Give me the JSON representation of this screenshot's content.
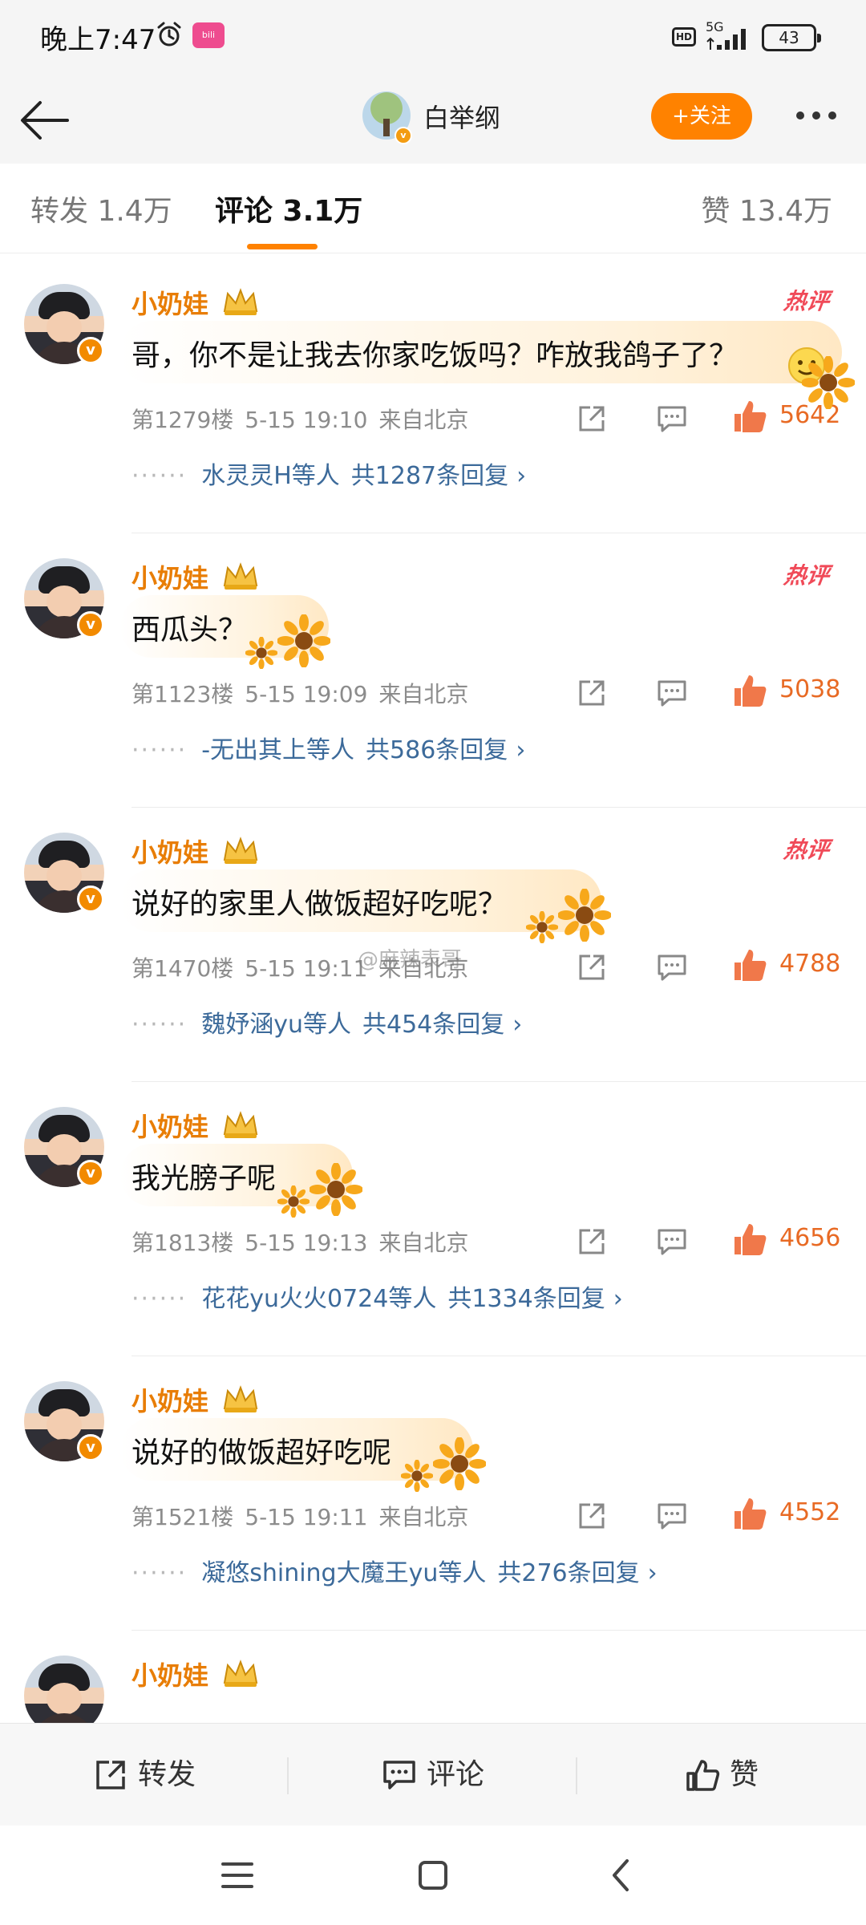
{
  "status_bar": {
    "time": "晚上7:47",
    "network": "5G",
    "hd": "HD",
    "battery": "43"
  },
  "header": {
    "user_name": "白举纲",
    "follow_label": "+关注"
  },
  "tabs": {
    "repost": "转发 1.4万",
    "comments": "评论 3.1万",
    "likes": "赞 13.4万"
  },
  "comments": [
    {
      "user": "小奶娃",
      "hot": "热评",
      "text": "哥，你不是让我去你家吃饭吗？咋放我鸽子了？",
      "floor": "第1279楼",
      "date": "5-15 19:10",
      "location": "来自北京",
      "likes": "5642",
      "reply_users": "水灵灵H等人",
      "reply_total": "共1287条回复"
    },
    {
      "user": "小奶娃",
      "hot": "热评",
      "text": "西瓜头？",
      "floor": "第1123楼",
      "date": "5-15 19:09",
      "location": "来自北京",
      "likes": "5038",
      "reply_users": "-无出其上等人",
      "reply_total": "共586条回复"
    },
    {
      "user": "小奶娃",
      "hot": "热评",
      "text": "说好的家里人做饭超好吃呢？",
      "floor": "第1470楼",
      "date": "5-15 19:11",
      "location": "来自北京",
      "likes": "4788",
      "reply_users": "魏妤涵yu等人",
      "reply_total": "共454条回复"
    },
    {
      "user": "小奶娃",
      "text": "我光膀子呢",
      "floor": "第1813楼",
      "date": "5-15 19:13",
      "location": "来自北京",
      "likes": "4656",
      "reply_users": "花花yu火火0724等人",
      "reply_total": "共1334条回复"
    },
    {
      "user": "小奶娃",
      "text": "说好的做饭超好吃呢",
      "floor": "第1521楼",
      "date": "5-15 19:11",
      "location": "来自北京",
      "likes": "4552",
      "reply_users": "凝悠shining大魔王yu等人",
      "reply_total": "共276条回复"
    },
    {
      "user": "小奶娃"
    }
  ],
  "watermark": "@麻辣表哥",
  "bottom_bar": {
    "repost": "转发",
    "comment": "评论",
    "like": "赞"
  },
  "colors": {
    "accent": "#ff8200",
    "name": "#e87d05",
    "link": "#3c6a9a",
    "hot": "#f04a58",
    "like": "#e86a24"
  },
  "icons": {
    "back": "arrow-left-icon",
    "more": "more-dots-icon",
    "share": "share-box-icon",
    "comment": "comment-bubble-icon",
    "like": "thumbs-up-icon",
    "crown": "crown-icon"
  }
}
